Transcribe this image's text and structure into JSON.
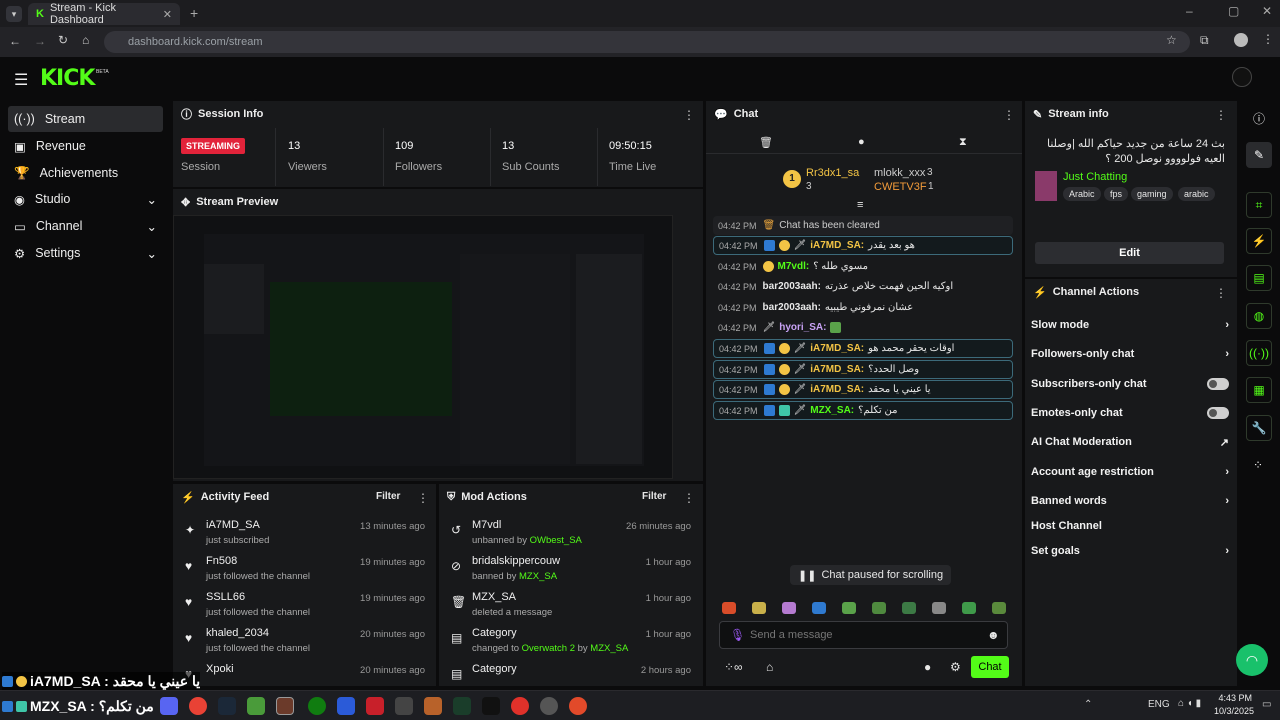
{
  "browser": {
    "tab_title": "Stream - Kick Dashboard",
    "url": "dashboard.kick.com/stream"
  },
  "logo": "KICK",
  "logo_sup": "BETA",
  "nav": {
    "items": [
      {
        "label": "Stream"
      },
      {
        "label": "Revenue"
      },
      {
        "label": "Achievements"
      },
      {
        "label": "Studio"
      },
      {
        "label": "Channel"
      },
      {
        "label": "Settings"
      }
    ]
  },
  "session": {
    "title": "Session Info",
    "status": "STREAMING",
    "status_label": "Session",
    "stats": [
      {
        "value": "13",
        "label": "Viewers"
      },
      {
        "value": "109",
        "label": "Followers"
      },
      {
        "value": "13",
        "label": "Sub Counts"
      },
      {
        "value": "09:50:15",
        "label": "Time Live"
      }
    ]
  },
  "preview": {
    "title": "Stream Preview"
  },
  "activity": {
    "title": "Activity Feed",
    "filter": "Filter",
    "items": [
      {
        "name": "iA7MD_SA",
        "sub": "just subscribed",
        "time": "13 minutes ago"
      },
      {
        "name": "Fn508",
        "sub": "just followed the channel",
        "time": "19 minutes ago"
      },
      {
        "name": "SSLL66",
        "sub": "just followed the channel",
        "time": "19 minutes ago"
      },
      {
        "name": "khaled_2034",
        "sub": "just followed the channel",
        "time": "20 minutes ago"
      },
      {
        "name": "Xpoki",
        "sub": "",
        "time": "20 minutes ago"
      }
    ]
  },
  "mod": {
    "title": "Mod Actions",
    "filter": "Filter",
    "items": [
      {
        "name": "M7vdl",
        "sub_pre": "unbanned by ",
        "sub_user": "OWbest_SA",
        "time": "26 minutes ago"
      },
      {
        "name": "bridalskippercouw",
        "sub_pre": "banned by ",
        "sub_user": "MZX_SA",
        "time": "1 hour ago"
      },
      {
        "name": "MZX_SA",
        "sub_pre": "deleted a message",
        "sub_user": "",
        "time": "1 hour ago"
      },
      {
        "name": "Category",
        "sub_pre": "changed to ",
        "sub_user": "Overwatch 2",
        "sub_post": " by ",
        "sub_user2": "MZX_SA",
        "time": "1 hour ago"
      },
      {
        "name": "Category",
        "sub_pre": "",
        "sub_user": "",
        "time": "2 hours ago"
      }
    ]
  },
  "chat": {
    "title": "Chat",
    "top": [
      {
        "rank": "1",
        "name": "Rr3dx1_sa",
        "count": "3"
      },
      {
        "name": "mlokk_xxx",
        "count": "3"
      },
      {
        "name": "CWETV3F",
        "count": "1"
      }
    ],
    "messages": [
      {
        "time": "04:42 PM",
        "user": "",
        "text": "Chat has been cleared"
      },
      {
        "time": "04:42 PM",
        "user": "iA7MD_SA:",
        "text": "هو بعد يقدر"
      },
      {
        "time": "04:42 PM",
        "user": "M7vdl:",
        "text": "مسوي طله ؟"
      },
      {
        "time": "04:42 PM",
        "user": "bar2003aah:",
        "text": "اوكيه الحين فهمت خلاص عذرته"
      },
      {
        "time": "04:42 PM",
        "user": "bar2003aah:",
        "text": "عشان نمرفوني طيبيه"
      },
      {
        "time": "04:42 PM",
        "user": "hyori_SA:",
        "text": ""
      },
      {
        "time": "04:42 PM",
        "user": "iA7MD_SA:",
        "text": "اوقات يحقر محمد هو"
      },
      {
        "time": "04:42 PM",
        "user": "iA7MD_SA:",
        "text": "وصل الحدد؟"
      },
      {
        "time": "04:42 PM",
        "user": "iA7MD_SA:",
        "text": "يا عيني يا محقد"
      },
      {
        "time": "04:42 PM",
        "user": "MZX_SA:",
        "text": "من تكلم؟"
      }
    ],
    "paused": "Chat paused for scrolling",
    "placeholder": "Send a message",
    "send": "Chat"
  },
  "streaminfo": {
    "title": "Stream info",
    "text": "بث 24 ساعة من جديد حياكم الله |وصلنا العيه فولوووو نوصل 200 ؟",
    "category": "Just Chatting",
    "tags": [
      "Arabic",
      "fps",
      "gaming",
      "arabic"
    ],
    "edit": "Edit"
  },
  "actions": {
    "title": "Channel Actions",
    "items": [
      {
        "label": "Slow mode",
        "ctl": "chevron"
      },
      {
        "label": "Followers-only chat",
        "ctl": "chevron"
      },
      {
        "label": "Subscribers-only chat",
        "ctl": "toggle"
      },
      {
        "label": "Emotes-only chat",
        "ctl": "toggle"
      },
      {
        "label": "AI Chat Moderation",
        "ctl": "ext"
      },
      {
        "label": "Account age restriction",
        "ctl": "chevron"
      },
      {
        "label": "Banned words",
        "ctl": "chevron"
      },
      {
        "label": "Host Channel",
        "ctl": ""
      },
      {
        "label": "Set goals",
        "ctl": "chevron"
      }
    ]
  },
  "overlay": {
    "line1": "iA7MD_SA : يا عيني يا محقد",
    "line2": "MZX_SA : من تكلم؟"
  },
  "taskbar": {
    "lang": "ENG",
    "time": "4:43 PM",
    "date": "10/3/2025"
  },
  "colors": {
    "accent": "#53fc18",
    "live": "#e2233a",
    "bg": "#0b0b0c",
    "panel": "#18191b"
  }
}
